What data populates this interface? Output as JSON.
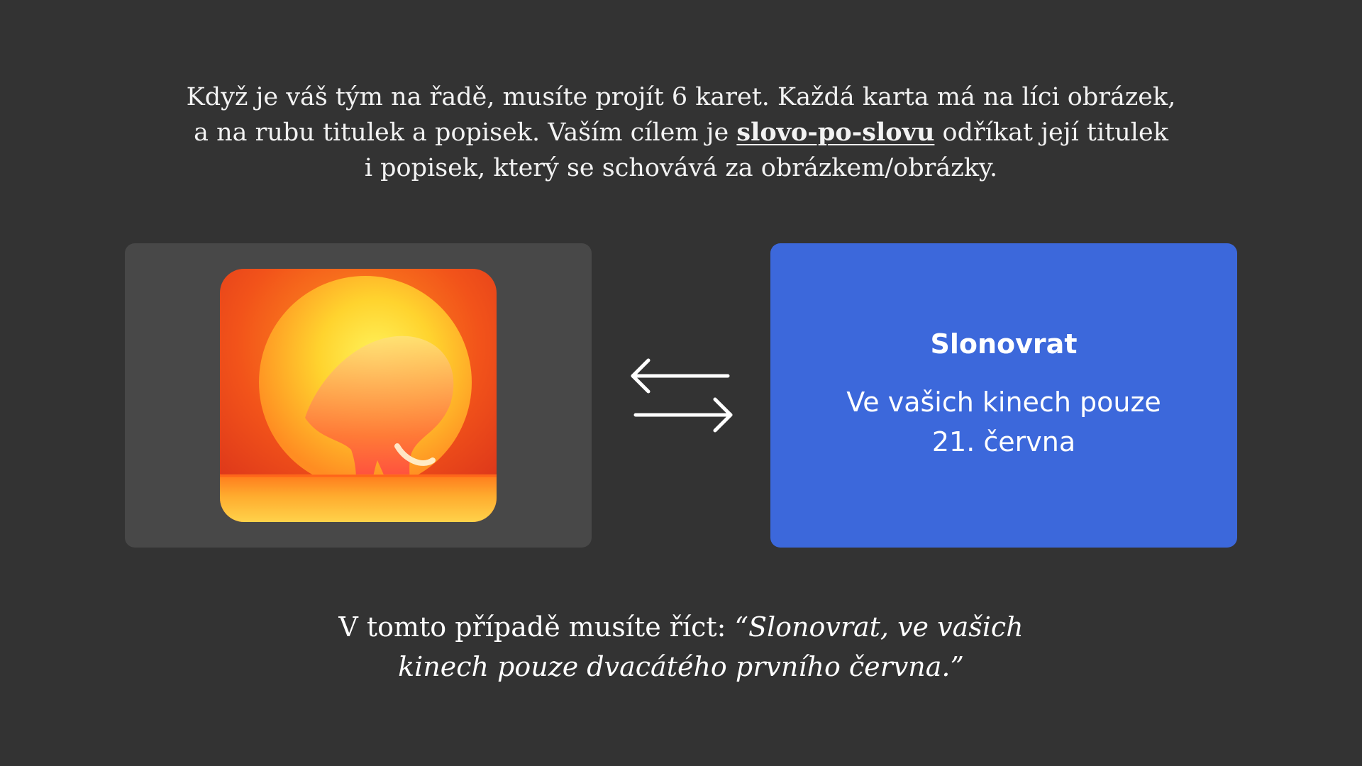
{
  "intro": {
    "line1": "Když je váš tým na řadě, musíte projít 6 karet. Každá karta má na líci obrázek,",
    "line2_before": "a na rubu titulek a popisek. Vaším cílem je ",
    "line2_emphasis": "slovo-po-slovu",
    "line2_after": " odříkat její titulek",
    "line3": "i popisek, který se schovává za obrázkem/obrázky."
  },
  "front_card": {
    "image": "elephant-silhouette-in-setting-sun-image"
  },
  "swap_icon": "swap-arrows-icon",
  "back_card": {
    "title": "Slonovrat",
    "caption_line1": "Ve vašich kinech pouze",
    "caption_line2": "21. června"
  },
  "outro": {
    "lead": "V tomto případě musíte říct: ",
    "quote_line1": "“Slonovrat, ve vašich",
    "quote_line2": "kinech pouze dvacátého prvního června.”"
  },
  "colors": {
    "background": "#333333",
    "front_card": "#484848",
    "back_card": "#3c68db",
    "text": "#ffffff"
  }
}
